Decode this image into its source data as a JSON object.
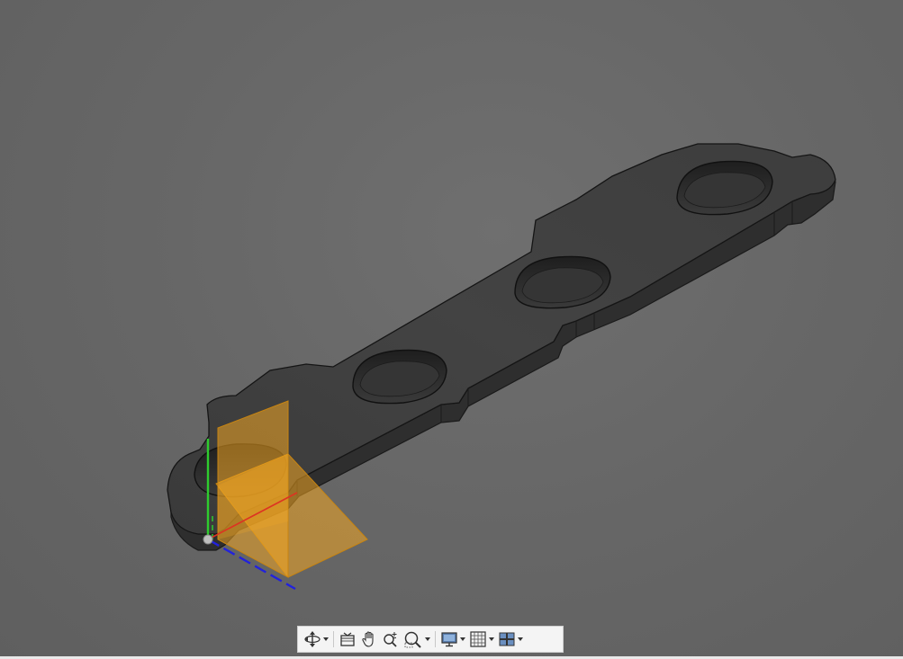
{
  "window": {
    "title": ""
  },
  "toolbar": {
    "tools": [
      {
        "id": "orbit",
        "icon": "orbit-icon",
        "has_dropdown": true
      },
      {
        "id": "look-at",
        "icon": "look-at-icon",
        "has_dropdown": false
      },
      {
        "id": "pan",
        "icon": "pan-hand-icon",
        "has_dropdown": false
      },
      {
        "id": "zoom",
        "icon": "zoom-icon",
        "has_dropdown": false
      },
      {
        "id": "fit",
        "icon": "zoom-window-icon",
        "has_dropdown": true
      },
      {
        "id": "display-settings",
        "icon": "monitor-icon",
        "has_dropdown": true
      },
      {
        "id": "grid-snaps",
        "icon": "grid-icon",
        "has_dropdown": true
      },
      {
        "id": "viewports",
        "icon": "viewports-icon",
        "has_dropdown": true
      }
    ]
  },
  "colors": {
    "background": "#676767",
    "part_top": "#414141",
    "part_side": "#303030",
    "origin_plane": "#f3a623",
    "axis_y": "#2ecc2e",
    "axis_z": "#2222dd",
    "axis_x": "#dd3322"
  }
}
